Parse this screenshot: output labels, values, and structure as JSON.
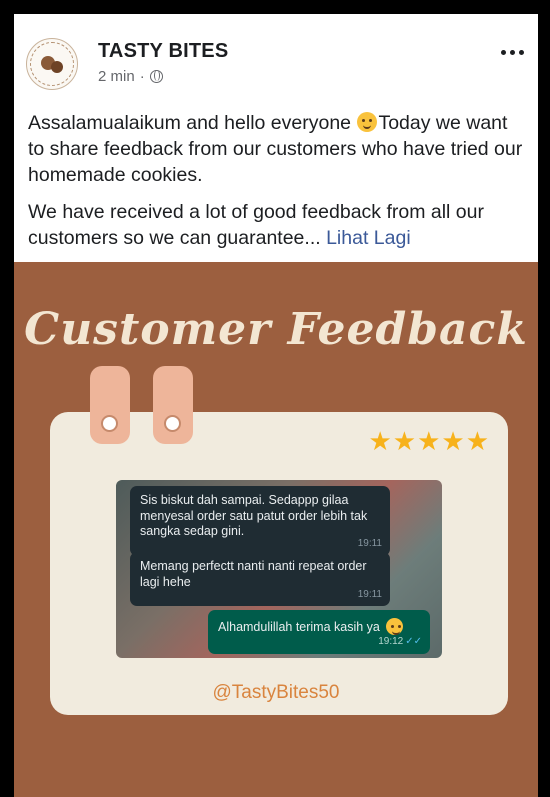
{
  "post": {
    "page_name": "TASTY BITES",
    "time": "2 min",
    "separator": "·",
    "text_1a": "Assalamualaikum and hello everyone ",
    "text_1b": "Today we want to share feedback from our customers who have tried our homemade cookies.",
    "text_2": "We have received a lot of good feedback from all our customers so we can guarantee... ",
    "see_more": "Lihat Lagi"
  },
  "image": {
    "title": "Customer Feedback",
    "rating_stars": "★★★★★",
    "rating": 5,
    "handle": "@TastyBites50",
    "messages": [
      {
        "text": "Sis biskut dah sampai. Sedappp gilaa menyesal order satu patut order lebih tak sangka sedap gini.",
        "time": "19:11",
        "direction": "incoming"
      },
      {
        "text": "Memang perfectt nanti nanti repeat order lagi hehe",
        "time": "19:11",
        "direction": "incoming"
      },
      {
        "text": "Alhamdulillah terima kasih ya",
        "time": "19:12",
        "direction": "outgoing"
      }
    ]
  },
  "icons": {
    "audience": "globe-icon",
    "menu": "more-icon",
    "emoji": "smiling-face-with-hearts-icon"
  },
  "colors": {
    "brown_bg": "#9c5f3f",
    "panel": "#f1ebde",
    "star": "#f7b21b",
    "handle": "#d9843e",
    "link": "#3b5998"
  }
}
